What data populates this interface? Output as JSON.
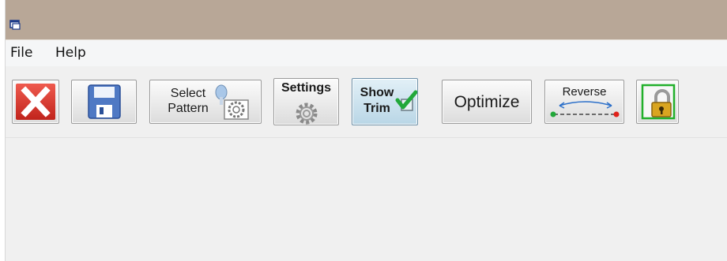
{
  "menu": {
    "file": "File",
    "help": "Help"
  },
  "toolbar": {
    "close_icon": "red-x-icon",
    "save_icon": "floppy-disk-icon",
    "select_pattern": {
      "line1": "Select",
      "line2": "Pattern",
      "icon": "gear-pattern-icon"
    },
    "settings": {
      "label": "Settings",
      "icon": "gear-icon"
    },
    "show_trim": {
      "line1": "Show",
      "line2": "Trim",
      "icon": "checkmark-icon"
    },
    "optimize": {
      "label": "Optimize"
    },
    "reverse": {
      "label": "Reverse",
      "icon": "reverse-arrows-icon"
    },
    "lock_icon": "padlock-icon"
  },
  "colors": {
    "titlebar": "#b8a797",
    "close_red": "#d9302b",
    "save_blue": "#4f79c4",
    "check_green": "#22a83a",
    "lock_border": "#22b02b"
  }
}
